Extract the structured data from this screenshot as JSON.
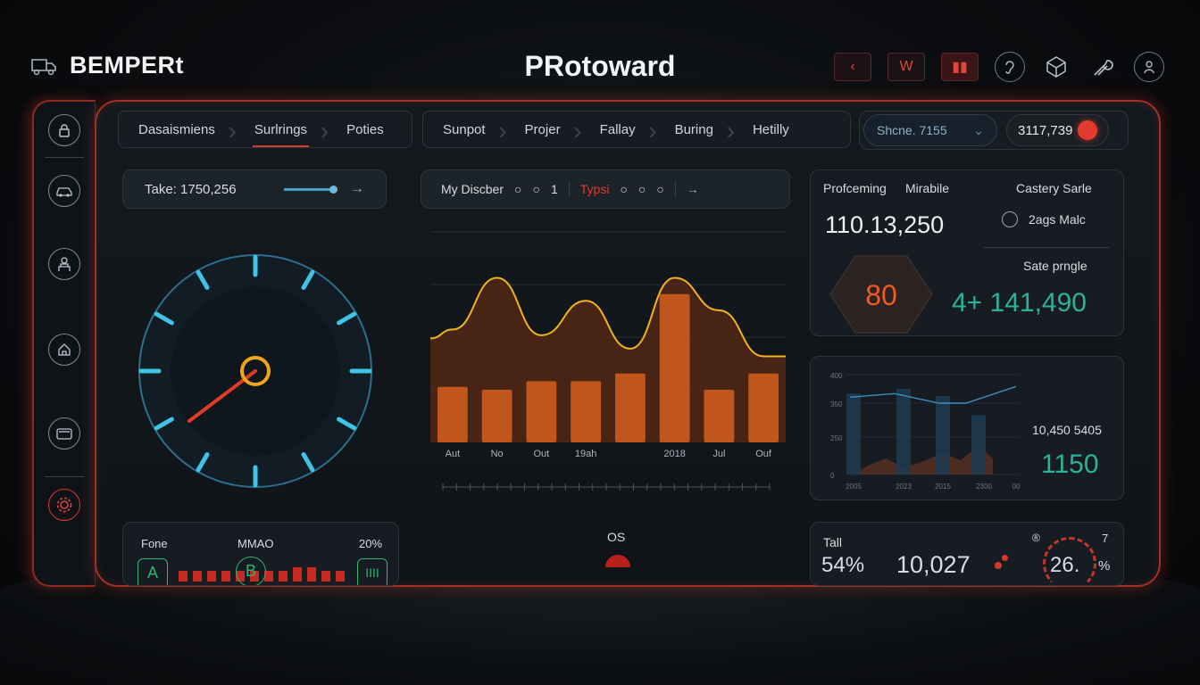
{
  "brand": {
    "name": "BEMPERt",
    "icon": "truck-icon"
  },
  "app_title": "PRotoward",
  "top_buttons": [
    {
      "label": "‹",
      "icon": "chevron-left-icon"
    },
    {
      "label": "W"
    },
    {
      "label": "▮▮",
      "icon": "pause-icon"
    }
  ],
  "top_icons": [
    "ear-icon",
    "cube-icon",
    "wrench-icon",
    "user-icon"
  ],
  "sidebar": [
    "lock-icon",
    "car-icon",
    "driver-icon",
    "home-icon",
    "wallet-icon",
    "settings-icon"
  ],
  "tabs_left": [
    "Dasaismiens",
    "Surlrings",
    "Poties"
  ],
  "tabs_left_active": 1,
  "tabs_mid": [
    "Sunpot",
    "Projer",
    "Fallay",
    "Buring",
    "Hetilly"
  ],
  "search": {
    "value": "Shcne. 7155"
  },
  "value_pill": "3117,739",
  "gauge_panel": {
    "label": "Take: 1750,256",
    "level": 0.92,
    "needle_fraction": 0.18
  },
  "chart_bar": {
    "label": "My Discber",
    "counter": "1",
    "type_label": "Typsi"
  },
  "chart_data": {
    "type": "bar",
    "categories": [
      "Aut",
      "No",
      "Out",
      "19ah",
      "",
      "2018",
      "Jul",
      "Ouf"
    ],
    "values": [
      58,
      55,
      64,
      64,
      72,
      155,
      55,
      72
    ],
    "line": [
      118,
      172,
      112,
      148,
      98,
      172,
      138,
      90
    ],
    "ylim": [
      0,
      220
    ]
  },
  "stats_panel": {
    "left_header": "Profceming",
    "mid_header": "Mirabile",
    "right_header": "Castery Sarle",
    "big_value": "110.13,250",
    "clock_label": "2ags Malc",
    "sub_label": "Sate prngle",
    "hex_value": "80",
    "green_value": "4+ 141,490"
  },
  "mini_chart": {
    "yticks": [
      "400",
      "350",
      "250",
      "0"
    ],
    "xticks": [
      "2005",
      "2023",
      "2015",
      "2300",
      "00"
    ],
    "value_label": "10,450 5405",
    "value": "1150",
    "chart_data": {
      "type": "bar",
      "values": [
        340,
        360,
        330,
        250
      ],
      "line": [
        325,
        340,
        300,
        300,
        370
      ],
      "ylim": [
        0,
        420
      ]
    }
  },
  "bottom_left": {
    "label_a": "Fone",
    "label_b": "MMAO",
    "label_c": "20%",
    "badges": [
      "A",
      "B",
      "IIII"
    ]
  },
  "bottom_mid": {
    "label": "OS"
  },
  "bottom_right": {
    "label": "Tall",
    "pct": "54%",
    "value": "10,027",
    "gauge_value": "26.",
    "gauge_unit": "%",
    "small_a": "®",
    "small_b": "7"
  },
  "colors": {
    "accent_red": "#e23a2e",
    "cyan": "#3fc4e6",
    "orange": "#c0561c",
    "green": "#2ab39a"
  }
}
